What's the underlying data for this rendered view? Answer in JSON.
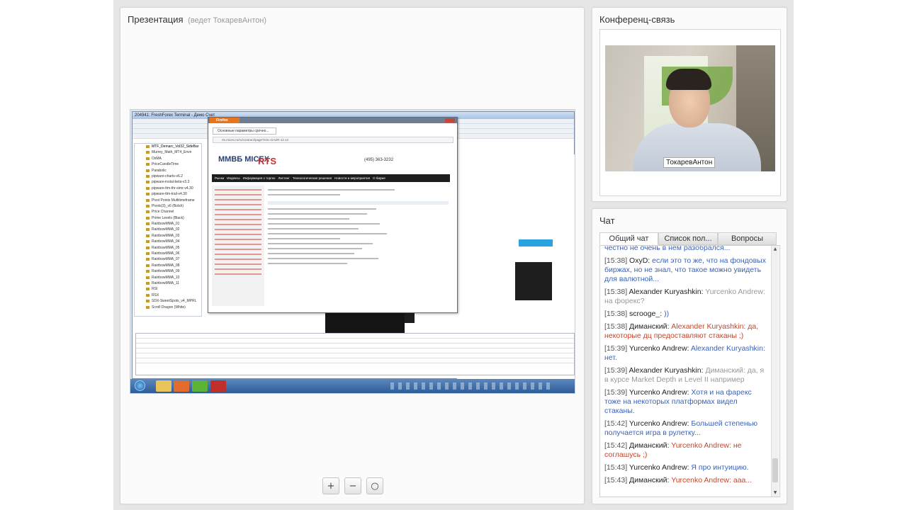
{
  "presentation": {
    "title": "Презентация",
    "presenter": "(ведет ТокаревАнтон)",
    "slide": {
      "terminal_title": "204941: FreshForex Terminal - Демо Счет",
      "browser_app": "Firefox",
      "browser_tab": "Основные параметры срочно...",
      "url": "rts.micex.ru/ru/contract/page?isin=GAZR-12.12",
      "logo_left": "ММВБ MICEX",
      "logo_right": "RTS",
      "phone": "(495) 363-3232",
      "menu_items": [
        "Рынки",
        "Индексы",
        "Информация о торгах",
        "Листинг",
        "Технологические решения",
        "Новости и мероприятия",
        "О бирже"
      ],
      "indicator_list": [
        "MTF_Demarc_Vol32_SideBar",
        "Murrey_Math_MT4_Envn",
        "OsMA",
        "PriceCandleTime",
        "Parabolic",
        "pipware-charts-v6.2",
        "pipware-instal-beta-v3.3",
        "pipware-ttm-thr-simr-v4.30",
        "pipware-ttm-trail-v4.30",
        "Pivot Points Multitimeframe",
        "Pivots(3)_v6 (Bolsh)",
        "Price Channel",
        "Prime Levels (Black)",
        "RainbowMMA_01",
        "RainbowMMA_02",
        "RainbowMMA_03",
        "RainbowMMA_04",
        "RainbowMMA_05",
        "RainbowMMA_06",
        "RainbowMMA_07",
        "RainbowMMA_08",
        "RainbowMMA_09",
        "RainbowMMA_10",
        "RainbowMMA_11",
        "RSI",
        "RSX",
        "SDX-SweetSpots_v4_MPRL",
        "Scroll Dragon (White)"
      ]
    },
    "zoom": {
      "zoom_in_glyph": "+",
      "zoom_out_glyph": "−",
      "zoom_fit_glyph": "○"
    }
  },
  "conference": {
    "title": "Конференц-связь",
    "video_label": "ТокаревАнтон"
  },
  "chat": {
    "title": "Чат",
    "tabs": [
      "Общий чат",
      "Список пол...",
      "Вопросы"
    ],
    "scroll_up": "▲",
    "scroll_down": "▼",
    "messages": [
      {
        "time": "",
        "user": "",
        "text": "честно не очень в нем разобрался...",
        "color": "blue"
      },
      {
        "time": "[15:38]",
        "user": "OxyD:",
        "text": "если это то же, что на фондовых биржах, но не знал, что такое можно увидеть для валютной...",
        "color": "blue"
      },
      {
        "time": "[15:38]",
        "user": "Alexander Kuryashkin:",
        "text": "Yurcenko Andrew: на форекс?",
        "color": "gray"
      },
      {
        "time": "[15:38]",
        "user": "scrooge_:",
        "text": "))",
        "color": "blue"
      },
      {
        "time": "[15:38]",
        "user": "Диманский:",
        "text": "Alexander Kuryashkin: да, некоторые дц предоставляют стаканы ;)",
        "color": "red"
      },
      {
        "time": "[15:39]",
        "user": "Yurcenko Andrew:",
        "text": "Alexander Kuryashkin: нет.",
        "color": "blue"
      },
      {
        "time": "[15:39]",
        "user": "Alexander Kuryashkin:",
        "text": "Диманский: да, я в курсе Market Depth и Level II например",
        "color": "gray"
      },
      {
        "time": "[15:39]",
        "user": "Yurcenko Andrew:",
        "text": "Хотя и на фарекс тоже на некоторых платформах видел стаканы.",
        "color": "blue"
      },
      {
        "time": "[15:42]",
        "user": "Yurcenko Andrew:",
        "text": "Большей степенью получается игра в рулетку...",
        "color": "blue"
      },
      {
        "time": "[15:42]",
        "user": "Диманский:",
        "text": "Yurcenko Andrew: не соглашусь ;)",
        "color": "red"
      },
      {
        "time": "[15:43]",
        "user": "Yurcenko Andrew:",
        "text": "Я про интуицию.",
        "color": "blue"
      },
      {
        "time": "[15:43]",
        "user": "Диманский:",
        "text": "Yurcenko Andrew: ааа...",
        "color": "red"
      }
    ]
  }
}
